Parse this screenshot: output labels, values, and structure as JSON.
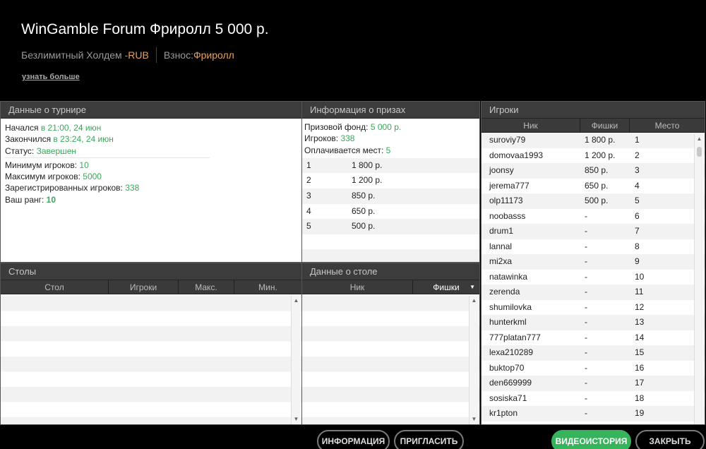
{
  "header": {
    "title": "WinGamble Forum Фриролл 5 000 р.",
    "game_type": "Безлимитный Холдем - ",
    "currency": "RUB",
    "buyin_label": "Взнос: ",
    "buyin_value": "Фриролл",
    "more_link": "узнать больше"
  },
  "tournament": {
    "title": "Данные о турнире",
    "started_label": "Начался ",
    "started_value": "в 21:00, 24 июн",
    "ended_label": "Закончился ",
    "ended_value": "в 23:24, 24 июн",
    "status_label": "Статус: ",
    "status_value": "Завершен",
    "min_label": "Минимум игроков: ",
    "min_value": "10",
    "max_label": "Максимум игроков: ",
    "max_value": "5000",
    "reg_label": "Зарегистрированных игроков: ",
    "reg_value": "338",
    "rank_label": "Ваш ранг: ",
    "rank_value": "10"
  },
  "prizes": {
    "title": "Информация о призах",
    "pool_label": "Призовой фонд: ",
    "pool_value": "5 000 р.",
    "players_label": "Игроков: ",
    "players_value": "338",
    "paid_label": "Оплачивается мест: ",
    "paid_value": "5",
    "rows": [
      {
        "place": "1",
        "prize": "1 800 р."
      },
      {
        "place": "2",
        "prize": "1 200 р."
      },
      {
        "place": "3",
        "prize": "850 р."
      },
      {
        "place": "4",
        "prize": "650 р."
      },
      {
        "place": "5",
        "prize": "500 р."
      }
    ]
  },
  "players": {
    "title": "Игроки",
    "col_nick": "Ник",
    "col_chips": "Фишки",
    "col_place": "Место",
    "rows": [
      {
        "nick": "suroviy79",
        "chips": "1 800 р.",
        "place": "1"
      },
      {
        "nick": "domovaa1993",
        "chips": "1 200 р.",
        "place": "2"
      },
      {
        "nick": "joonsy",
        "chips": "850 р.",
        "place": "3"
      },
      {
        "nick": "jerema777",
        "chips": "650 р.",
        "place": "4"
      },
      {
        "nick": "olp11173",
        "chips": "500 р.",
        "place": "5"
      },
      {
        "nick": "noobasss",
        "chips": "-",
        "place": "6"
      },
      {
        "nick": "drum1",
        "chips": "-",
        "place": "7"
      },
      {
        "nick": "lannal",
        "chips": "-",
        "place": "8"
      },
      {
        "nick": "mi2xa",
        "chips": "-",
        "place": "9"
      },
      {
        "nick": "natawinka",
        "chips": "-",
        "place": "10"
      },
      {
        "nick": "zerenda",
        "chips": "-",
        "place": "11"
      },
      {
        "nick": "shumilovka",
        "chips": "-",
        "place": "12"
      },
      {
        "nick": "hunterkml",
        "chips": "-",
        "place": "13"
      },
      {
        "nick": "777platan777",
        "chips": "-",
        "place": "14"
      },
      {
        "nick": "lexa210289",
        "chips": "-",
        "place": "15"
      },
      {
        "nick": "buktop70",
        "chips": "-",
        "place": "16"
      },
      {
        "nick": "den669999",
        "chips": "-",
        "place": "17"
      },
      {
        "nick": "sosiska71",
        "chips": "-",
        "place": "18"
      },
      {
        "nick": "kr1pton",
        "chips": "-",
        "place": "19"
      }
    ]
  },
  "tables": {
    "title": "Столы",
    "col_table": "Стол",
    "col_players": "Игроки",
    "col_max": "Макс.",
    "col_min": "Мин."
  },
  "table_data": {
    "title": "Данные о столе",
    "col_nick": "Ник",
    "col_chips": "Фишки"
  },
  "buttons": {
    "info": "ИНФОРМАЦИЯ",
    "invite": "ПРИГЛАСИТЬ",
    "video": "ВИДЕОИСТОРИЯ",
    "close": "ЗАКРЫТЬ"
  },
  "colors": {
    "accent_green": "#35b45b",
    "value_green": "#3aa85a",
    "orange": "#e8a15b"
  }
}
